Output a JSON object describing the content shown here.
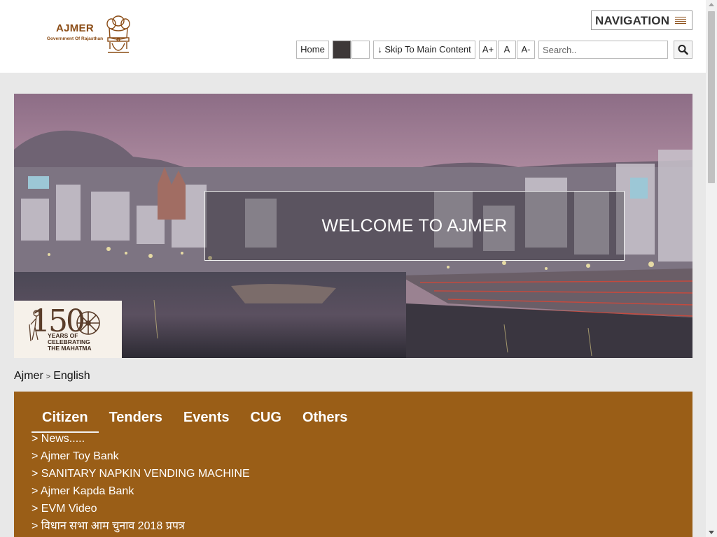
{
  "header": {
    "logo_title": "AJMER",
    "logo_subtitle": "Government Of Rajasthan",
    "navigation_label": "NAVIGATION",
    "toolbar": {
      "home": "Home",
      "skip": "↓ Skip To Main Content",
      "font_increase": "A+",
      "font_normal": "A",
      "font_decrease": "A-"
    },
    "search_placeholder": "Search.."
  },
  "hero": {
    "welcome": "WELCOME TO AJMER",
    "badge_number": "150",
    "badge_caption_line1": "YEARS OF",
    "badge_caption_line2": "CELEBRATING",
    "badge_caption_line3": "THE MAHATMA"
  },
  "breadcrumb": {
    "home": "Ajmer",
    "separator": ">",
    "current": "English"
  },
  "panel": {
    "tabs": [
      "Citizen",
      "Tenders",
      "Events",
      "CUG",
      "Others"
    ],
    "active_tab": "Citizen",
    "news": [
      "> News.....",
      "> Ajmer Toy Bank",
      "> SANITARY NAPKIN VENDING MACHINE",
      "> Ajmer Kapda Bank",
      "> EVM Video",
      "> विधान सभा आम चुनाव 2018 प्रपत्र"
    ]
  },
  "colors": {
    "brand_brown": "#9a5e17",
    "logo_brown": "#8a4b14",
    "header_bg": "#ffffff",
    "page_bg": "#e8e8e8"
  },
  "icons": {
    "navigation": "hamburger-menu-icon",
    "search": "magnifier-icon"
  }
}
